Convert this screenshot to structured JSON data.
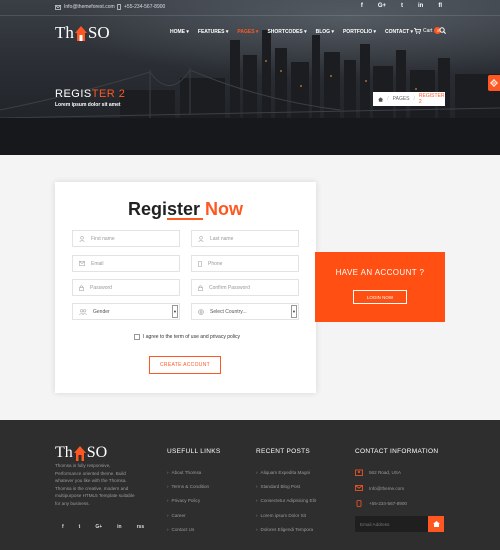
{
  "topbar": {
    "email": "Info@themeforest.com",
    "phone": "+55-234-567-8900",
    "social": [
      "f",
      "G+",
      "t",
      "in",
      "fl"
    ]
  },
  "brand": {
    "logo_left": "Th",
    "logo_right": "SO",
    "accent": "#ff5722"
  },
  "nav": {
    "items": [
      {
        "label": "HOME ▾"
      },
      {
        "label": "FEATURES ▾"
      },
      {
        "label": "PAGES ▾"
      },
      {
        "label": "SHORTCODES ▾"
      },
      {
        "label": "BLOG ▾"
      },
      {
        "label": "PORTFOLIO ▾"
      },
      {
        "label": "CONTACT ▾"
      }
    ],
    "cart_label": "Cart",
    "cart_count": "0"
  },
  "hero": {
    "title_main": "REGIS",
    "title_accent": "TER 2",
    "subtitle": "Lorem ipsum dolor sit amet",
    "breadcrumb": {
      "home_icon": "home-icon",
      "section": "PAGES",
      "current": "REGISTER 2"
    }
  },
  "register": {
    "title": "Register",
    "title_accent": "Now",
    "fields": {
      "first_name": "First name",
      "last_name": "Last name",
      "email": "Email",
      "phone": "Phone",
      "password": "Password",
      "confirm_password": "Confirm Password",
      "gender": "Gender",
      "country": "Select Country..."
    },
    "agree": "I agree to the term of use and privacy policy",
    "submit": "CREATE ACCOUNT"
  },
  "have_account": {
    "title": "HAVE AN ACCOUNT ?",
    "button": "LOGIN NOW"
  },
  "footer": {
    "about": "Thomsa is fully responsive, Performance oriented theme. Build whatever you like with the Thomsa. Thomsa is the creative, modern and multipurpose HTML5 Template suitable for any business.",
    "social": [
      "f",
      "t",
      "G+",
      "in",
      "rss"
    ],
    "links_title": "USEFULL LINKS",
    "links": [
      "About Thomsa",
      "Terms & Condition",
      "Privacy Policy",
      "Career",
      "Contact Us"
    ],
    "posts_title": "RECENT POSTS",
    "posts": [
      "Aliquam Expedita Magni",
      "Standard Blog Post",
      "Consectetur Adipisicing Elit",
      "Lorem ipsum Dolor Sit",
      "Dolores Eligendi Tempora"
    ],
    "contact_title": "CONTACT INFORMATION",
    "contact": {
      "address": "562 Road, USA",
      "email": "Info@theme.com",
      "phone": "+55-234-567-8900"
    },
    "email_placeholder": "Email Address"
  }
}
